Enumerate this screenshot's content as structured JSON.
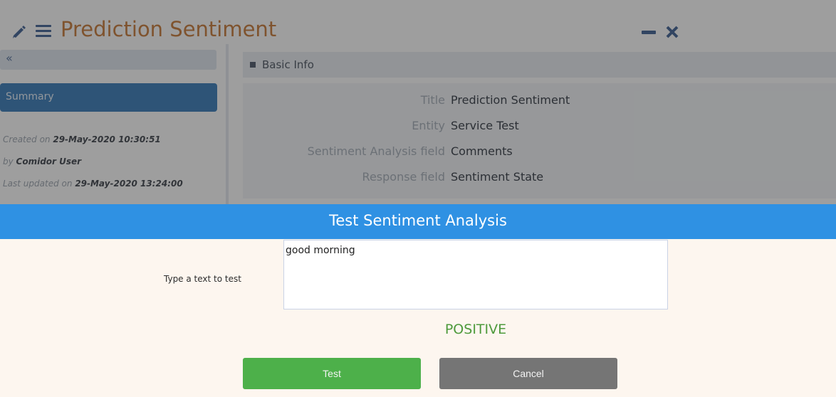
{
  "window": {
    "title": "Prediction Sentiment",
    "icons": {
      "edit": "pencil-icon",
      "menu": "hamburger-icon",
      "minimize": "minimize-icon",
      "close": "close-icon"
    }
  },
  "left_panel": {
    "collapse_glyph": "«",
    "summary_label": "Summary",
    "created_prefix": "Created on",
    "created_value": "29-May-2020 10:30:51",
    "by_prefix": "by",
    "by_value": "Comidor User",
    "updated_prefix": "Last updated on",
    "updated_value": "29-May-2020 13:24:00"
  },
  "basic_info": {
    "header": "Basic Info",
    "fields": [
      {
        "label": "Title",
        "value": "Prediction Sentiment"
      },
      {
        "label": "Entity",
        "value": "Service Test"
      },
      {
        "label": "Sentiment Analysis field",
        "value": "Comments"
      },
      {
        "label": "Response field",
        "value": "Sentiment State"
      }
    ]
  },
  "dialog": {
    "title": "Test Sentiment Analysis",
    "input_label": "Type a text to test",
    "input_value": "good morning",
    "result": "POSITIVE",
    "test_button": "Test",
    "cancel_button": "Cancel"
  },
  "colors": {
    "dialog_header": "#2f91e3",
    "title_orange": "#c77733",
    "result_green": "#4e9a3c",
    "test_button": "#4db04a",
    "cancel_button": "#757575",
    "summary_button": "#3479b8"
  }
}
